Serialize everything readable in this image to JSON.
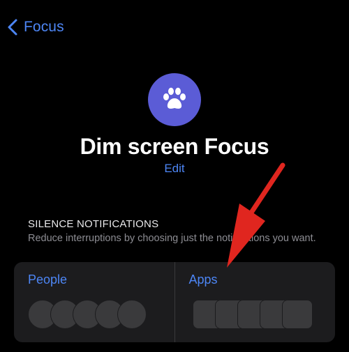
{
  "nav": {
    "back_label": "Focus",
    "back_icon": "chevron-left-icon"
  },
  "focus": {
    "icon": "paw-icon",
    "icon_bg_color": "#5b5cd6",
    "title": "Dim screen Focus",
    "edit_label": "Edit"
  },
  "silence": {
    "header": "SILENCE NOTIFICATIONS",
    "description": "Reduce interruptions by choosing just the notifications you want.",
    "people_label": "People",
    "apps_label": "Apps"
  },
  "colors": {
    "accent": "#4d86f5",
    "background": "#000000",
    "card": "#1c1c1e",
    "annotation": "#e0261f"
  }
}
